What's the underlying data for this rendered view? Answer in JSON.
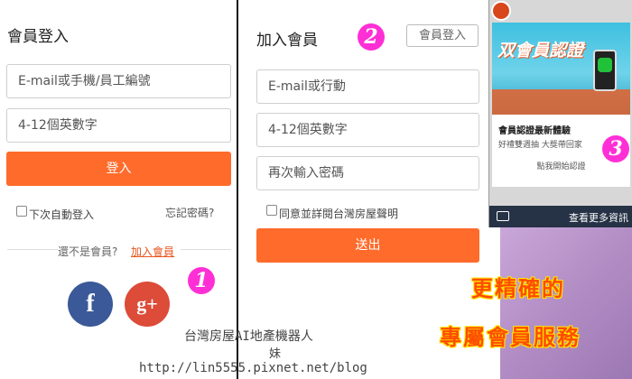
{
  "login": {
    "title": "會員登入",
    "email_placeholder": "E-mail或手機/員工編號",
    "password_placeholder": "4-12個英數字",
    "login_button": "登入",
    "remember_label": "下次自動登入",
    "forgot_link": "忘記密碼?",
    "not_member_text": "還不是會員?",
    "join_link": "加入會員",
    "facebook_label": "f",
    "google_label": "g+"
  },
  "register": {
    "title": "加入會員",
    "login_button": "會員登入",
    "email_placeholder": "E-mail或行動",
    "password_placeholder": "4-12個英數字",
    "confirm_placeholder": "再次輸入密碼",
    "agree_label": "同意並詳閱台灣房屋聲明",
    "submit_button": "送出"
  },
  "promo": {
    "banner_title": "双會員認證",
    "card_heading": "會員認證最新體驗",
    "card_sub": "好禮雙週抽 大獎帶回家",
    "card_link": "點我開始認證",
    "bottom_bar_text": "查看更多資訊"
  },
  "badges": [
    "1",
    "2",
    "3"
  ],
  "overlay": {
    "line1": "更精確的",
    "line2": "專屬會員服務"
  },
  "watermark": {
    "line1": "台灣房屋AI地產機器人",
    "line2": "妹",
    "line3": "http://lin5555.pixnet.net/blog"
  },
  "colors": {
    "accent": "#ff6b2b",
    "badge": "#ff2fd6",
    "facebook": "#3b5998",
    "google": "#dd4b39"
  }
}
